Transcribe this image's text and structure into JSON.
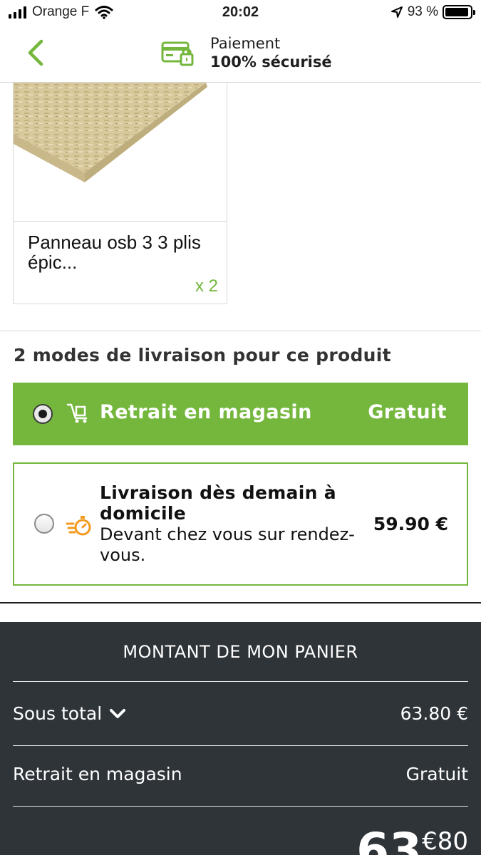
{
  "status_bar": {
    "carrier": "Orange F",
    "time": "20:02",
    "battery": "93 %"
  },
  "header": {
    "secure_line1": "Paiement",
    "secure_line2": "100% sécurisé"
  },
  "product": {
    "name": "Panneau osb 3 3 plis épic...",
    "quantity": "x 2"
  },
  "delivery": {
    "section_title": "2 modes de livraison pour ce produit",
    "options": [
      {
        "label": "Retrait en magasin",
        "price": "Gratuit",
        "selected": true
      },
      {
        "title": "Livraison dès demain à domicile",
        "subtitle": "Devant chez vous sur rendez-vous.",
        "price": "59.90 €",
        "selected": false
      }
    ]
  },
  "summary": {
    "title": "MONTANT DE MON PANIER",
    "rows": [
      {
        "label": "Sous total",
        "value": "63.80 €"
      },
      {
        "label": "Retrait en magasin",
        "value": "Gratuit"
      }
    ],
    "total_integer": "63",
    "total_decimal": "€80"
  },
  "colors": {
    "brand_green": "#74b73c",
    "summary_bg": "#2f3439"
  }
}
